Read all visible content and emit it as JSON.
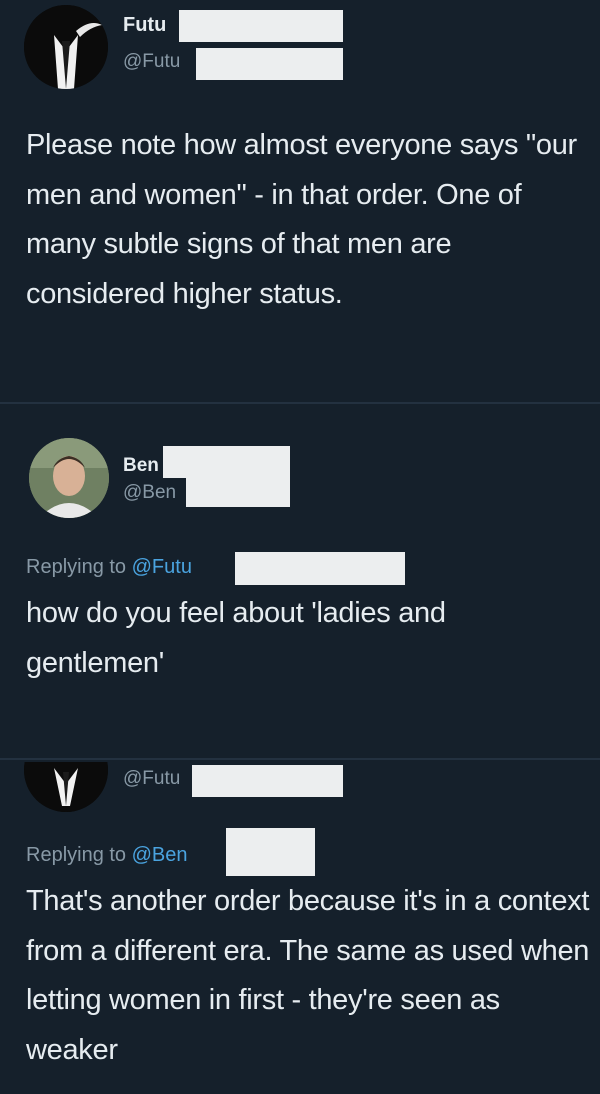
{
  "tweets": [
    {
      "name": "Futu",
      "handle": "@Futu",
      "text": "Please note how almost everyone says \"our men and women\" - in that order. One of many subtle signs of that men are considered higher status."
    },
    {
      "name": "Ben",
      "handle": "@Ben",
      "replying_prefix": "Replying to ",
      "replying_to": "@Futu",
      "text": "how do you feel about 'ladies and gentlemen'"
    },
    {
      "handle": "@Futu",
      "replying_prefix": "Replying to ",
      "replying_to": "@Ben",
      "text": "That's another order because it's in a context from a different era. The same as used when letting women in first - they're seen as weaker"
    }
  ]
}
